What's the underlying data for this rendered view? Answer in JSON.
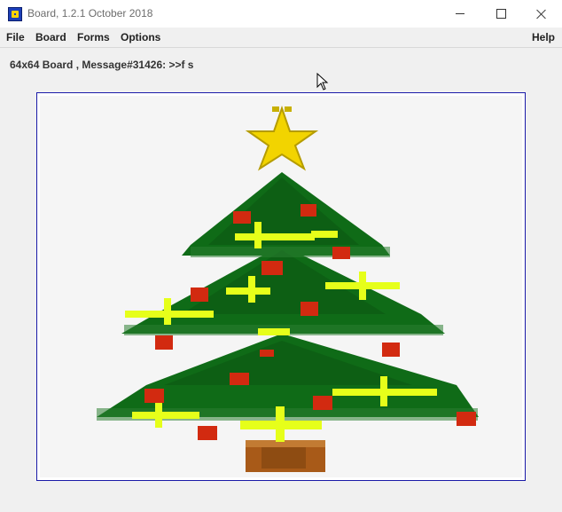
{
  "window": {
    "title": "Board, 1.2.1 October 2018",
    "icon": "board-app-icon",
    "controls": [
      "minimize-icon",
      "maximize-icon",
      "close-icon"
    ]
  },
  "menubar": {
    "file": "File",
    "board": "Board",
    "forms": "Forms",
    "options": "Options",
    "help": "Help"
  },
  "status": {
    "text": "64x64 Board , Message#31426: >>f s"
  },
  "board": {
    "grid": "64x64",
    "image": "christmas-tree",
    "colors": {
      "background": "#f5f5f5",
      "tree_green": "#0f6b17",
      "dark_green": "#0a4d10",
      "star_yellow": "#f2d400",
      "light_yellow": "#e6ff1a",
      "ornament_red": "#d22a10",
      "trunk_brown": "#a85a18",
      "frame_blue": "#1a1aa8"
    }
  }
}
